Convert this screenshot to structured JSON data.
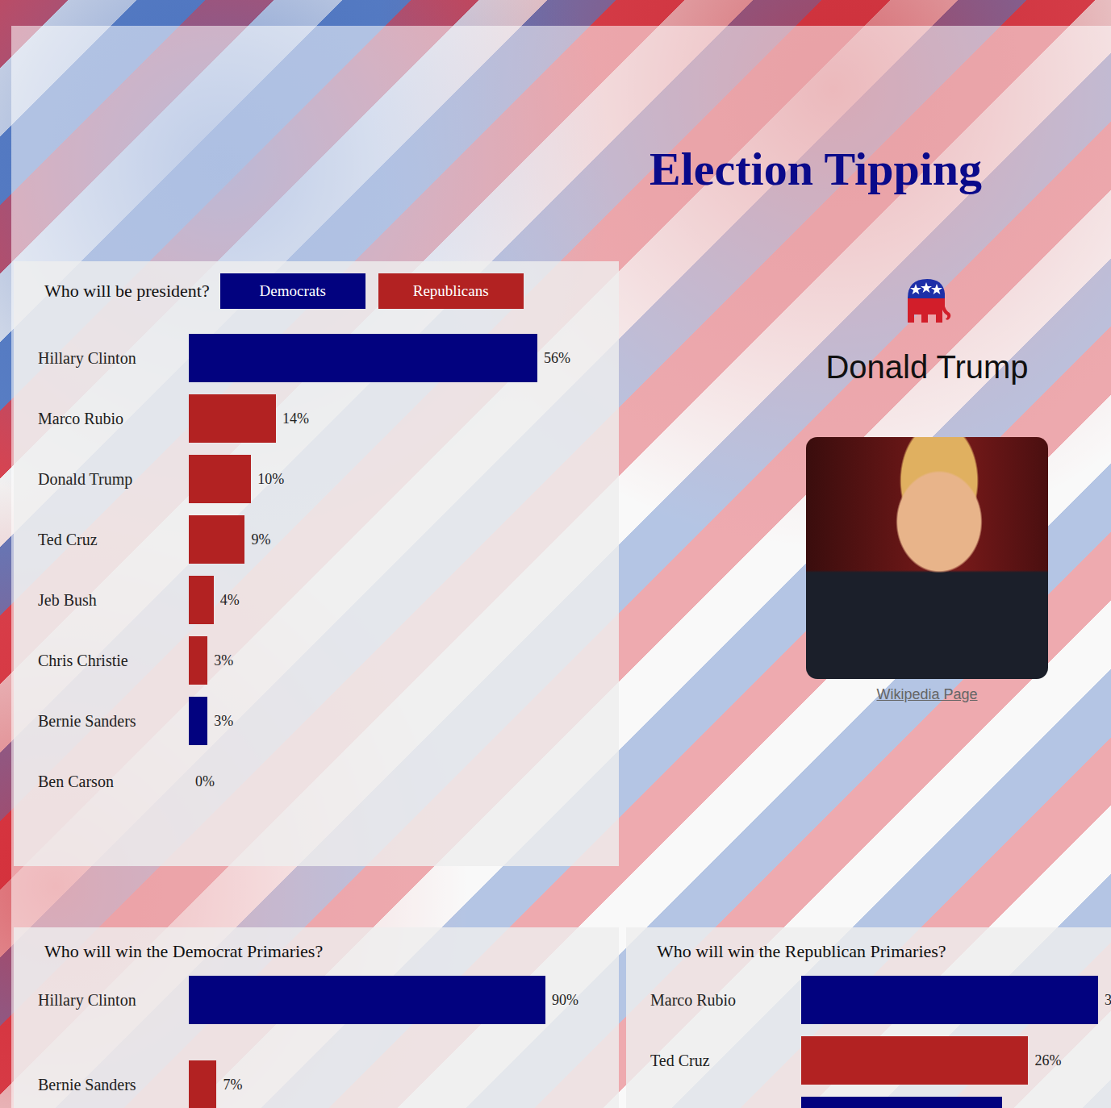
{
  "title": "Election Tipping",
  "president_chart": {
    "question": "Who will be president?",
    "filters": [
      {
        "label": "Democrats",
        "color": "#02027f"
      },
      {
        "label": "Republicans",
        "color": "#b22222"
      }
    ],
    "bars": [
      {
        "name": "Hillary Clinton",
        "value": 56,
        "label": "56%",
        "color": "#02027f"
      },
      {
        "name": "Marco Rubio",
        "value": 14,
        "label": "14%",
        "color": "#b22222"
      },
      {
        "name": "Donald Trump",
        "value": 10,
        "label": "10%",
        "color": "#b22222"
      },
      {
        "name": "Ted Cruz",
        "value": 9,
        "label": "9%",
        "color": "#b22222"
      },
      {
        "name": "Jeb Bush",
        "value": 4,
        "label": "4%",
        "color": "#b22222"
      },
      {
        "name": "Chris Christie",
        "value": 3,
        "label": "3%",
        "color": "#b22222"
      },
      {
        "name": "Bernie Sanders",
        "value": 3,
        "label": "3%",
        "color": "#02027f"
      },
      {
        "name": "Ben Carson",
        "value": 0,
        "label": "0%",
        "color": "#b22222"
      }
    ]
  },
  "candidate": {
    "name": "Donald Trump",
    "link": "Wikipedia Page"
  },
  "democrat_primaries": {
    "question": "Who will win the Democrat Primaries?",
    "bars": [
      {
        "name": "Hillary Clinton",
        "value": 90,
        "label": "90%",
        "color": "#02027f"
      },
      {
        "name": "Bernie Sanders",
        "value": 7,
        "label": "7%",
        "color": "#b22222"
      }
    ]
  },
  "republican_primaries": {
    "question": "Who will win the Republican Primaries?",
    "bars": [
      {
        "name": "Marco Rubio",
        "value": 34,
        "label": "3",
        "color": "#02027f"
      },
      {
        "name": "Ted Cruz",
        "value": 26,
        "label": "26%",
        "color": "#b22222"
      },
      {
        "name": "",
        "value": 23,
        "label": "",
        "color": "#02027f"
      }
    ]
  }
}
